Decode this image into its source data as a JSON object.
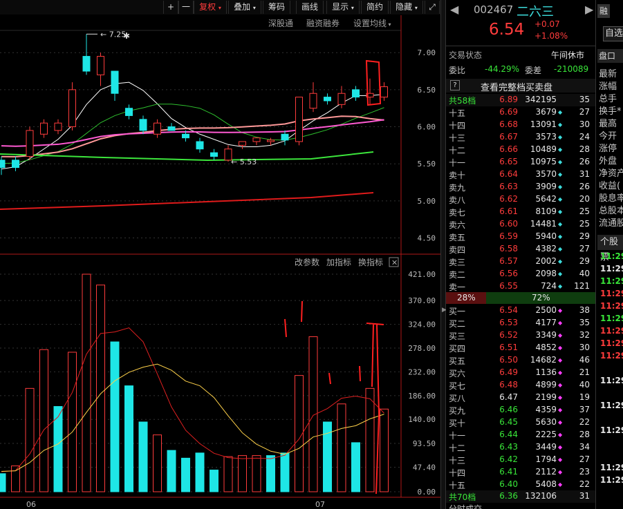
{
  "toolbar": {
    "plus": "+",
    "minus": "一",
    "fuquan": "复权",
    "diejia": "叠加",
    "choumа": "筹码",
    "huaxian": "画线",
    "xianshi": "显示",
    "jiandai": "简约",
    "yincang": "隐藏"
  },
  "subbar": {
    "shengutong": "深股通",
    "rongzi": "融资融券",
    "setma": "设置均线"
  },
  "price_axis": [
    "7.00",
    "6.50",
    "6.00",
    "5.50",
    "5.00",
    "4.50"
  ],
  "annot_high": "7.25",
  "annot_low": "5.53",
  "vol_toolbar": {
    "gai": "改参数",
    "jia": "加指标",
    "huan": "换指标",
    "close": "✕"
  },
  "vol_axis": [
    "421.00",
    "370.00",
    "324.00",
    "278.00",
    "232.00",
    "186.00",
    "140.00",
    "93.50",
    "47.40",
    "0.00"
  ],
  "x_labels": [
    "06",
    "07"
  ],
  "chart_data": {
    "type": "candlestick+volume",
    "price_ylim": [
      4.3,
      7.3
    ],
    "volume_ylim": [
      0,
      421
    ],
    "candles": [
      {
        "o": 5.45,
        "c": 5.55,
        "h": 5.6,
        "l": 5.35,
        "up": false
      },
      {
        "o": 5.45,
        "c": 5.55,
        "h": 5.6,
        "l": 5.4,
        "up": false
      },
      {
        "o": 5.6,
        "c": 5.95,
        "h": 6.0,
        "l": 5.55,
        "up": true
      },
      {
        "o": 5.9,
        "c": 6.05,
        "h": 6.1,
        "l": 5.85,
        "up": true
      },
      {
        "o": 5.95,
        "c": 6.05,
        "h": 6.1,
        "l": 5.9,
        "up": true
      },
      {
        "o": 6.0,
        "c": 6.5,
        "h": 6.6,
        "l": 5.95,
        "up": true
      },
      {
        "o": 6.75,
        "c": 6.95,
        "h": 7.25,
        "l": 6.7,
        "up": false
      },
      {
        "o": 6.7,
        "c": 6.95,
        "h": 7.0,
        "l": 6.55,
        "up": true
      },
      {
        "o": 6.75,
        "c": 6.45,
        "h": 6.75,
        "l": 6.35,
        "up": false
      },
      {
        "o": 6.25,
        "c": 6.15,
        "h": 6.3,
        "l": 6.1,
        "up": false
      },
      {
        "o": 6.1,
        "c": 5.95,
        "h": 6.15,
        "l": 5.9,
        "up": false
      },
      {
        "o": 5.9,
        "c": 6.05,
        "h": 6.1,
        "l": 5.85,
        "up": true
      },
      {
        "o": 6.0,
        "c": 5.95,
        "h": 6.05,
        "l": 5.95,
        "up": false
      },
      {
        "o": 5.9,
        "c": 5.85,
        "h": 5.95,
        "l": 5.8,
        "up": false
      },
      {
        "o": 5.8,
        "c": 5.7,
        "h": 5.85,
        "l": 5.65,
        "up": false
      },
      {
        "o": 5.65,
        "c": 5.6,
        "h": 5.7,
        "l": 5.55,
        "up": false
      },
      {
        "o": 5.55,
        "c": 5.7,
        "h": 5.75,
        "l": 5.53,
        "up": true
      },
      {
        "o": 5.75,
        "c": 5.8,
        "h": 5.8,
        "l": 5.7,
        "up": true
      },
      {
        "o": 5.8,
        "c": 5.85,
        "h": 5.85,
        "l": 5.75,
        "up": true
      },
      {
        "o": 5.82,
        "c": 5.8,
        "h": 5.85,
        "l": 5.75,
        "up": true
      },
      {
        "o": 5.82,
        "c": 5.9,
        "h": 5.95,
        "l": 5.75,
        "up": false
      },
      {
        "o": 5.8,
        "c": 6.4,
        "h": 6.4,
        "l": 5.75,
        "up": true
      },
      {
        "o": 6.25,
        "c": 6.45,
        "h": 6.6,
        "l": 6.2,
        "up": true
      },
      {
        "o": 6.35,
        "c": 6.4,
        "h": 6.45,
        "l": 6.3,
        "up": false
      },
      {
        "o": 6.3,
        "c": 6.45,
        "h": 6.55,
        "l": 6.25,
        "up": true
      },
      {
        "o": 6.5,
        "c": 6.4,
        "h": 6.55,
        "l": 6.35,
        "up": false
      },
      {
        "o": 6.45,
        "c": 6.4,
        "h": 6.65,
        "l": 6.3,
        "up": true
      },
      {
        "o": 6.4,
        "c": 6.54,
        "h": 6.6,
        "l": 6.35,
        "up": true
      }
    ],
    "volumes": [
      {
        "v": 35,
        "up": false
      },
      {
        "v": 50,
        "up": true
      },
      {
        "v": 200,
        "up": true
      },
      {
        "v": 275,
        "up": true
      },
      {
        "v": 165,
        "up": false
      },
      {
        "v": 270,
        "up": true
      },
      {
        "v": 421,
        "up": true
      },
      {
        "v": 400,
        "up": true
      },
      {
        "v": 290,
        "up": false
      },
      {
        "v": 205,
        "up": false
      },
      {
        "v": 135,
        "up": false
      },
      {
        "v": 110,
        "up": true
      },
      {
        "v": 80,
        "up": false
      },
      {
        "v": 65,
        "up": false
      },
      {
        "v": 75,
        "up": false
      },
      {
        "v": 42,
        "up": false
      },
      {
        "v": 68,
        "up": true
      },
      {
        "v": 70,
        "up": true
      },
      {
        "v": 70,
        "up": true
      },
      {
        "v": 70,
        "up": false
      },
      {
        "v": 75,
        "up": false
      },
      {
        "v": 225,
        "up": true
      },
      {
        "v": 300,
        "up": true
      },
      {
        "v": 135,
        "up": false
      },
      {
        "v": 170,
        "up": true
      },
      {
        "v": 95,
        "up": false
      },
      {
        "v": 200,
        "up": true
      },
      {
        "v": 160,
        "up": true
      }
    ]
  },
  "quote": {
    "code": "002467",
    "name": "二六三",
    "price": "6.54",
    "change": "+0.07",
    "pct": "+1.08%",
    "btn_rong": "融",
    "btn_zixuan": "自选",
    "status_label": "交易状态",
    "status_value": "午间休市",
    "weibi_label": "委比",
    "weibi_value": "-44.29%",
    "weicha_label": "委差",
    "weicha_value": "-210089",
    "full_book": "查看完整档买卖盘",
    "q": "?",
    "ask_total_label": "共58档",
    "ask_total_price": "6.89",
    "ask_total_vol": "342195",
    "ask_total_cnt": "35",
    "bid_total_label": "共70档",
    "bid_total_price": "6.36",
    "bid_total_vol": "132106",
    "bid_total_cnt": "31",
    "ratio_sell": "28%",
    "ratio_buy": "72%",
    "asks": [
      {
        "l": "十五",
        "p": "6.69",
        "v": "3679",
        "c": "27"
      },
      {
        "l": "十四",
        "p": "6.68",
        "v": "13091",
        "c": "30"
      },
      {
        "l": "十三",
        "p": "6.67",
        "v": "3573",
        "c": "24"
      },
      {
        "l": "十二",
        "p": "6.66",
        "v": "10489",
        "c": "28"
      },
      {
        "l": "十一",
        "p": "6.65",
        "v": "10975",
        "c": "26"
      },
      {
        "l": "卖十",
        "p": "6.64",
        "v": "3570",
        "c": "31"
      },
      {
        "l": "卖九",
        "p": "6.63",
        "v": "3909",
        "c": "26"
      },
      {
        "l": "卖八",
        "p": "6.62",
        "v": "5642",
        "c": "20"
      },
      {
        "l": "卖七",
        "p": "6.61",
        "v": "8109",
        "c": "25"
      },
      {
        "l": "卖六",
        "p": "6.60",
        "v": "14481",
        "c": "25"
      },
      {
        "l": "卖五",
        "p": "6.59",
        "v": "5940",
        "c": "29"
      },
      {
        "l": "卖四",
        "p": "6.58",
        "v": "4382",
        "c": "27"
      },
      {
        "l": "卖三",
        "p": "6.57",
        "v": "2002",
        "c": "29"
      },
      {
        "l": "卖二",
        "p": "6.56",
        "v": "2098",
        "c": "40"
      },
      {
        "l": "卖一",
        "p": "6.55",
        "v": "724",
        "c": "121"
      }
    ],
    "bids": [
      {
        "l": "买一",
        "p": "6.54",
        "v": "2500",
        "c": "38",
        "col": "red"
      },
      {
        "l": "买二",
        "p": "6.53",
        "v": "4177",
        "c": "35",
        "col": "red"
      },
      {
        "l": "买三",
        "p": "6.52",
        "v": "3349",
        "c": "32",
        "col": "red"
      },
      {
        "l": "买四",
        "p": "6.51",
        "v": "4852",
        "c": "30",
        "col": "red"
      },
      {
        "l": "买五",
        "p": "6.50",
        "v": "14682",
        "c": "46",
        "col": "red"
      },
      {
        "l": "买六",
        "p": "6.49",
        "v": "1136",
        "c": "21",
        "col": "red"
      },
      {
        "l": "买七",
        "p": "6.48",
        "v": "4899",
        "c": "40",
        "col": "red"
      },
      {
        "l": "买八",
        "p": "6.47",
        "v": "2199",
        "c": "19",
        "col": "white"
      },
      {
        "l": "买九",
        "p": "6.46",
        "v": "4359",
        "c": "37",
        "col": "green"
      },
      {
        "l": "买十",
        "p": "6.45",
        "v": "5630",
        "c": "22",
        "col": "green"
      },
      {
        "l": "十一",
        "p": "6.44",
        "v": "2225",
        "c": "28",
        "col": "green"
      },
      {
        "l": "十二",
        "p": "6.43",
        "v": "3449",
        "c": "34",
        "col": "green"
      },
      {
        "l": "十三",
        "p": "6.42",
        "v": "1794",
        "c": "27",
        "col": "green"
      },
      {
        "l": "十四",
        "p": "6.41",
        "v": "2112",
        "c": "23",
        "col": "green"
      },
      {
        "l": "十五",
        "p": "6.40",
        "v": "5408",
        "c": "22",
        "col": "green"
      }
    ],
    "footer_partial": "分时成交"
  },
  "far": {
    "tab": "盘口",
    "items": [
      "最新",
      "涨幅",
      "总手",
      "换手*",
      "最高",
      "今开",
      "涨停",
      "外盘",
      "净资产",
      "收益(",
      "股息率",
      "总股本",
      "流通股"
    ],
    "tab2": "个股票",
    "times": [
      {
        "t": "11:29",
        "c": "green"
      },
      {
        "t": "11:29",
        "c": "white"
      },
      {
        "t": "11:29",
        "c": "green"
      },
      {
        "t": "11:29",
        "c": "red"
      },
      {
        "t": "11:29",
        "c": "red"
      },
      {
        "t": "11:29",
        "c": "green"
      },
      {
        "t": "11:29",
        "c": "red"
      },
      {
        "t": "11:29",
        "c": "red"
      },
      {
        "t": "11:29",
        "c": "red"
      },
      {
        "t": "11:29",
        "c": "white"
      },
      {
        "t": "11:29",
        "c": "white"
      },
      {
        "t": "11:29",
        "c": "white"
      },
      {
        "t": "11:29",
        "c": "white"
      },
      {
        "t": "11:29",
        "c": "white"
      }
    ]
  },
  "colors": {
    "up": "#ff3c3c",
    "down": "#1ee6e6",
    "ma5": "#ffffff",
    "ma10": "#ffd24a",
    "ma20": "#ff5ad2",
    "ma30": "#3ce63c",
    "ma60": "#ff9999",
    "ma250": "#e01b1b"
  }
}
